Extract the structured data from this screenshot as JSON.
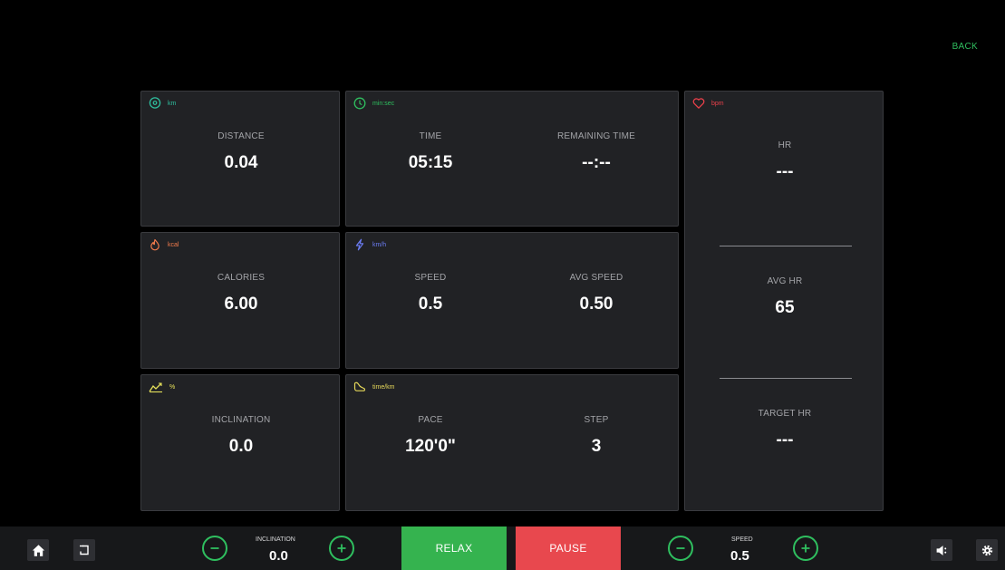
{
  "header": {
    "back_label": "BACK"
  },
  "cards": {
    "distance": {
      "unit": "km",
      "label": "DISTANCE",
      "value": "0.04",
      "color": "#2fbf9f"
    },
    "time": {
      "unit": "min:sec",
      "color": "#2fbf5f",
      "left": {
        "label": "TIME",
        "value": "05:15"
      },
      "right": {
        "label": "REMAINING TIME",
        "value": "--:--"
      }
    },
    "calories": {
      "unit": "kcal",
      "label": "CALORIES",
      "value": "6.00",
      "color": "#f07a4c"
    },
    "speed": {
      "unit": "km/h",
      "color": "#6b7cf2",
      "left": {
        "label": "SPEED",
        "value": "0.5"
      },
      "right": {
        "label": "AVG SPEED",
        "value": "0.50"
      }
    },
    "inclination": {
      "unit": "%",
      "label": "INCLINATION",
      "value": "0.0",
      "color": "#e6e15a"
    },
    "pace": {
      "unit": "time/km",
      "color": "#e6d85a",
      "left": {
        "label": "PACE",
        "value": "120'0\""
      },
      "right": {
        "label": "STEP",
        "value": "3"
      }
    },
    "heart": {
      "unit": "bpm",
      "color": "#e8404a",
      "hr": {
        "label": "HR",
        "value": "---"
      },
      "avg_hr": {
        "label": "AVG HR",
        "value": "65"
      },
      "target_hr": {
        "label": "TARGET HR",
        "value": "---"
      }
    }
  },
  "bottom_bar": {
    "home_icon": "home-icon",
    "exit_icon": "exit-icon",
    "inclination": {
      "label": "INCLINATION",
      "value": "0.0"
    },
    "relax_label": "RELAX",
    "pause_label": "PAUSE",
    "speed": {
      "label": "SPEED",
      "value": "0.5"
    },
    "volume_icon": "volume-icon",
    "settings_icon": "gear-icon",
    "colors": {
      "accent": "#2fbf5f",
      "relax": "#35b34f",
      "pause": "#e8484e"
    }
  }
}
